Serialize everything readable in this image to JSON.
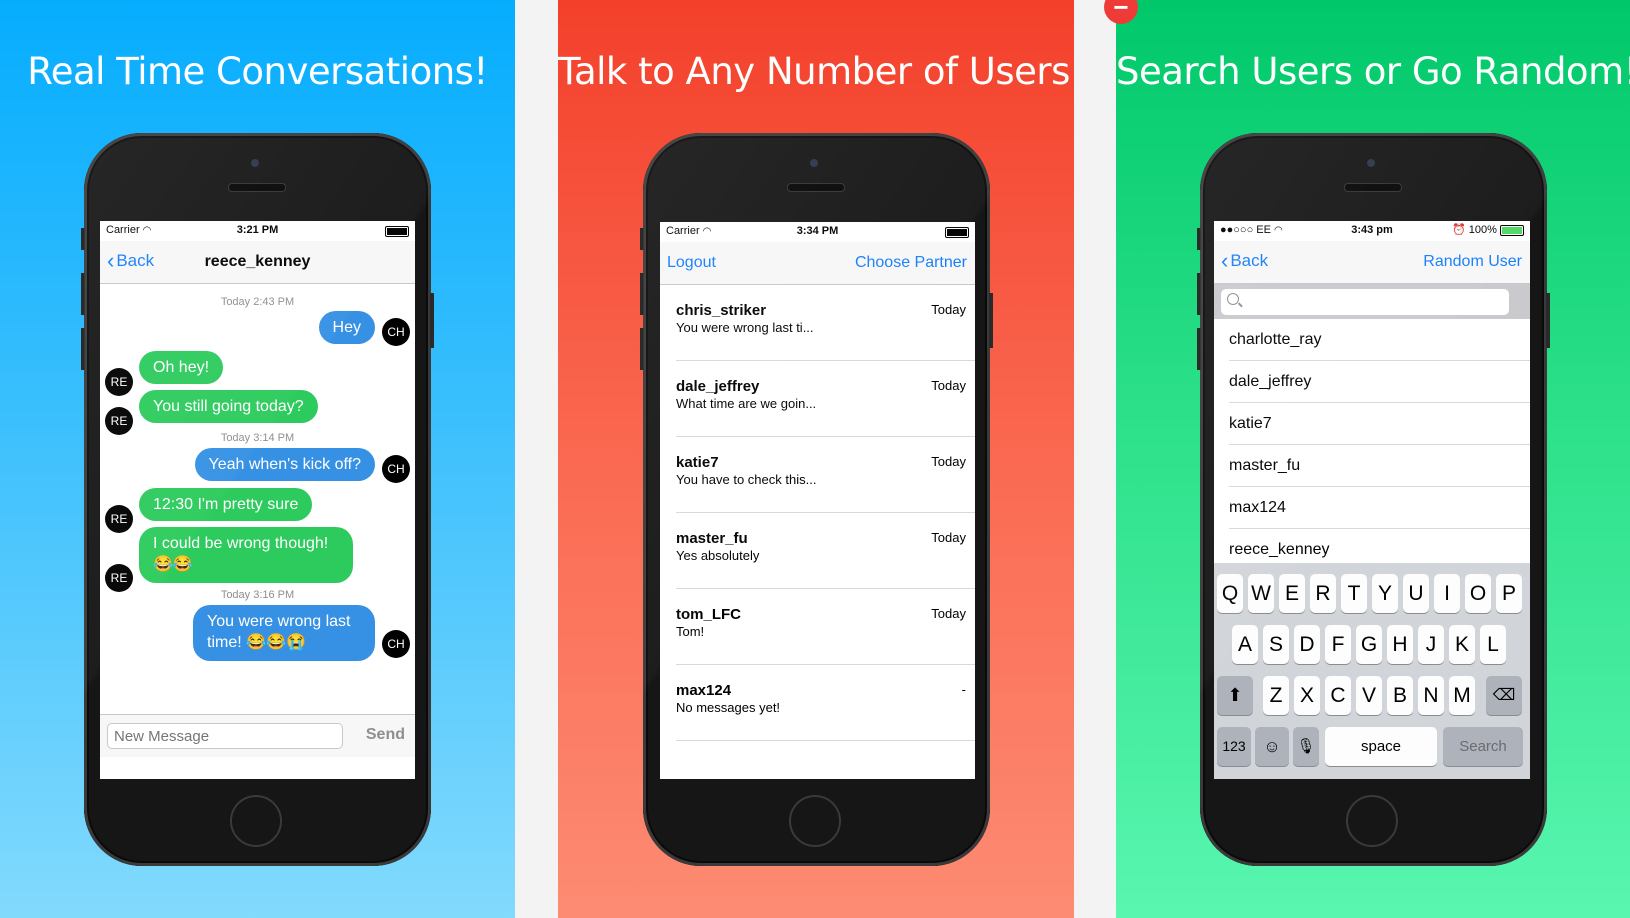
{
  "panels": {
    "chat_panel": {
      "headline": "Real Time Conversations!"
    },
    "list_panel": {
      "headline": "Talk to Any Number of Users!"
    },
    "search_panel": {
      "headline": "Search Users or Go Random!"
    }
  },
  "chat_screen": {
    "status": {
      "carrier": "Carrier",
      "time": "3:21 PM"
    },
    "nav": {
      "back_label": "Back",
      "title": "reece_kenney"
    },
    "timestamps": [
      "Today 2:43 PM",
      "Today 3:14 PM",
      "Today 3:16 PM"
    ],
    "messages": [
      {
        "text": "Hey",
        "avatar": "CH"
      },
      {
        "text": "Oh hey!",
        "avatar": "RE"
      },
      {
        "text": "You still going today?",
        "avatar": "RE"
      },
      {
        "text": "Yeah when's kick off?",
        "avatar": "CH"
      },
      {
        "text": "12:30 I'm pretty sure",
        "avatar": "RE"
      },
      {
        "text": "I could be wrong though!",
        "text2": "😂😂",
        "avatar": "RE"
      },
      {
        "text": "You were wrong last",
        "text2": "time! 😂😂😭",
        "avatar": "CH"
      }
    ],
    "input": {
      "placeholder": "New Message",
      "send_label": "Send"
    }
  },
  "list_screen": {
    "status": {
      "carrier": "Carrier",
      "time": "3:34 PM"
    },
    "nav": {
      "left_label": "Logout",
      "right_label": "Choose Partner"
    },
    "conversations": [
      {
        "name": "chris_striker",
        "preview": "You were wrong last ti...",
        "time": "Today"
      },
      {
        "name": "dale_jeffrey",
        "preview": "What time are we goin...",
        "time": "Today"
      },
      {
        "name": "katie7",
        "preview": "You have to check this...",
        "time": "Today"
      },
      {
        "name": "master_fu",
        "preview": "Yes absolutely",
        "time": "Today"
      },
      {
        "name": "tom_LFC",
        "preview": "Tom!",
        "time": "Today"
      },
      {
        "name": "max124",
        "preview": "No messages yet!",
        "time": "-"
      }
    ]
  },
  "search_screen": {
    "status": {
      "carrier": "●●○○○ EE",
      "time": "3:43 pm",
      "battery": "100%"
    },
    "nav": {
      "back_label": "Back",
      "right_label": "Random User"
    },
    "search": {
      "placeholder": ""
    },
    "users": [
      "charlotte_ray",
      "dale_jeffrey",
      "katie7",
      "master_fu",
      "max124",
      "reece_kenney"
    ],
    "keyboard": {
      "row1": [
        "Q",
        "W",
        "E",
        "R",
        "T",
        "Y",
        "U",
        "I",
        "O",
        "P"
      ],
      "row2": [
        "A",
        "S",
        "D",
        "F",
        "G",
        "H",
        "J",
        "K",
        "L"
      ],
      "row3": [
        "Z",
        "X",
        "C",
        "V",
        "B",
        "N",
        "M"
      ],
      "numbers_label": "123",
      "space_label": "space",
      "search_label": "Search"
    }
  },
  "colors": {
    "ios_blue": "#157efb",
    "bubble_in": "#2dcb5d",
    "bubble_out": "#3691e4"
  },
  "icons": [
    "wifi-icon",
    "battery-icon",
    "back-chevron-icon",
    "search-icon",
    "shift-icon",
    "delete-icon",
    "emoji-icon",
    "mic-icon",
    "alarm-icon",
    "remove-badge-icon"
  ]
}
